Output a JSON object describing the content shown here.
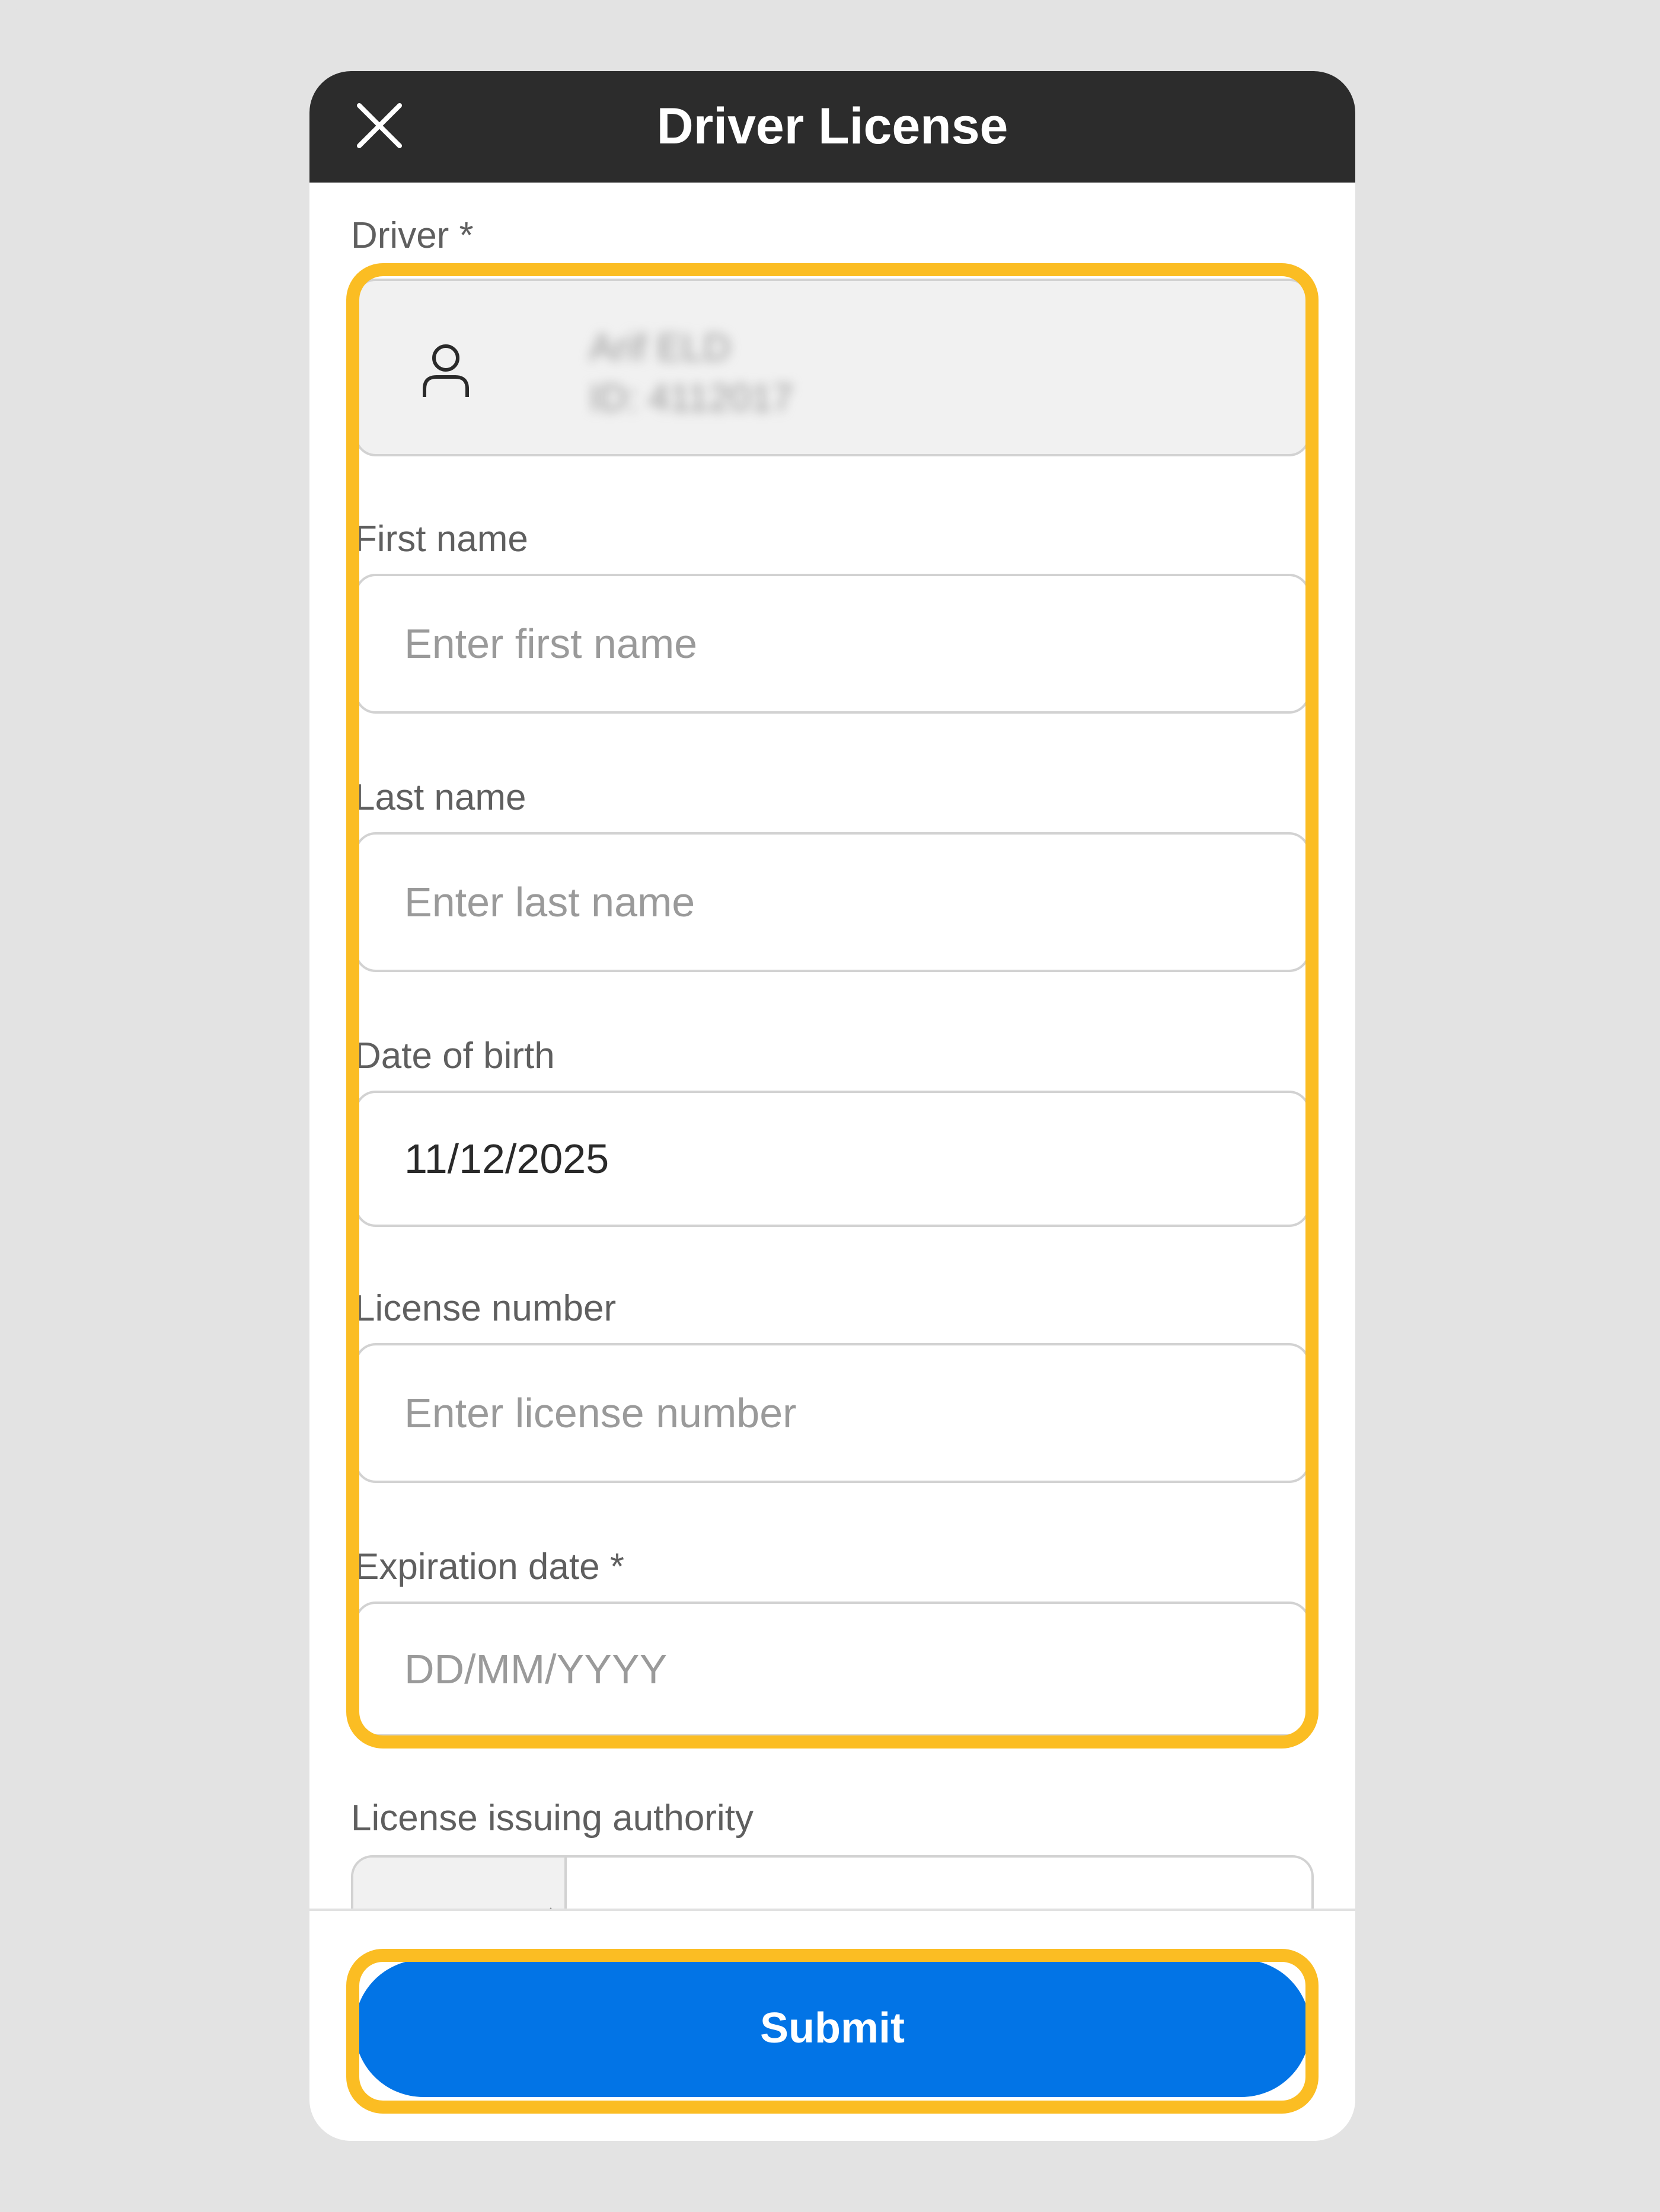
{
  "header": {
    "title": "Driver License",
    "close_icon": "close-icon"
  },
  "form": {
    "driver_label": "Driver *",
    "driver_card": {
      "icon": "user-icon",
      "name": "Arif ELD",
      "id": "ID: 4112017"
    },
    "first_name": {
      "label": "First name",
      "placeholder": "Enter first name"
    },
    "last_name": {
      "label": "Last name",
      "placeholder": "Enter last name"
    },
    "date_of_birth": {
      "label": "Date of birth",
      "value": "11/12/2025"
    },
    "license_number": {
      "label": "License number",
      "placeholder": "Enter license number"
    },
    "expiration_date": {
      "label": "Expiration date *",
      "placeholder": "DD/MM/YYYY"
    },
    "issuing_authority": {
      "label": "License issuing authority"
    }
  },
  "footer": {
    "submit_label": "Submit"
  },
  "colors": {
    "header_bg": "#2c2c2c",
    "highlight": "#fbbd23",
    "primary": "#0274e6"
  }
}
